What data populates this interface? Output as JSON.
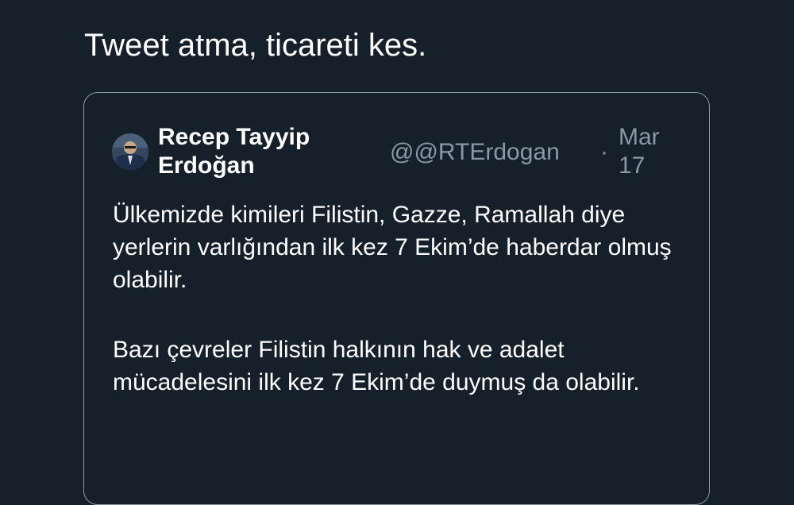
{
  "tweet": {
    "text": "Tweet atma, ticareti kes."
  },
  "quoted_tweet": {
    "author_name": "Recep Tayyip Erdoğan",
    "author_handle": "@@RTErdogan",
    "separator": "·",
    "date": "Mar 17",
    "paragraphs": [
      "Ülkemizde kimileri Filistin, Gazze, Ramallah diye yerlerin varlığından ilk kez 7 Ekim’de haberdar olmuş olabilir.",
      "Bazı çevreler Filistin halkının hak ve adalet mücadelesini ilk kez 7 Ekim’de duymuş da olabilir."
    ]
  },
  "colors": {
    "background": "#15202b",
    "text_primary": "#ffffff",
    "text_secondary": "#8b98a5",
    "card_border": "#8b98a5"
  }
}
